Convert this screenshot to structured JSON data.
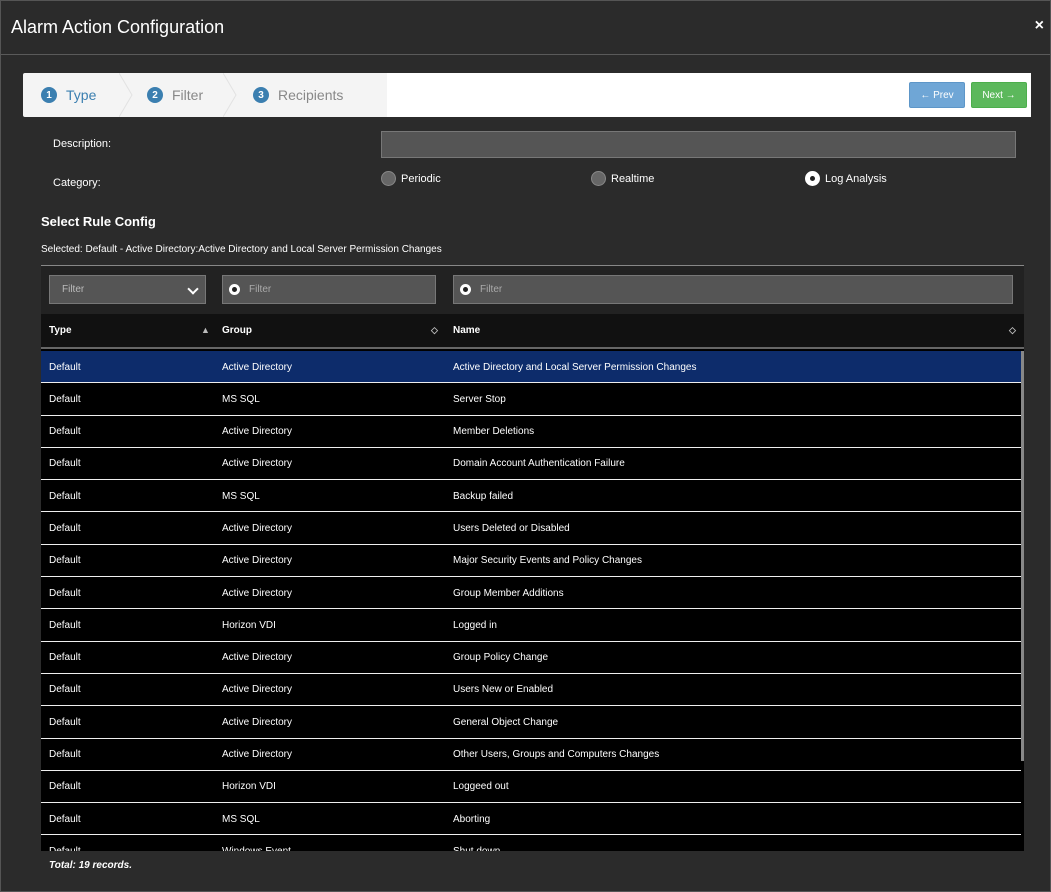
{
  "window": {
    "title": "Alarm Action Configuration",
    "close": "×"
  },
  "wizard": {
    "steps": [
      {
        "num": "1",
        "label": "Type"
      },
      {
        "num": "2",
        "label": "Filter"
      },
      {
        "num": "3",
        "label": "Recipients"
      }
    ],
    "prev_label": "← Prev",
    "next_label": "Next →"
  },
  "form": {
    "description_label": "Description:",
    "description_value": "",
    "category_label": "Category:",
    "categories": [
      {
        "label": "Periodic",
        "selected": false
      },
      {
        "label": "Realtime",
        "selected": false
      },
      {
        "label": "Log Analysis",
        "selected": true
      }
    ]
  },
  "rule_config": {
    "title": "Select Rule Config",
    "selected_text": "Selected: Default - Active Directory:Active Directory and Local Server Permission Changes"
  },
  "table": {
    "filters": {
      "type_placeholder": "Filter",
      "group_placeholder": "Filter",
      "name_placeholder": "Filter"
    },
    "columns": [
      "Type",
      "Group",
      "Name"
    ],
    "rows": [
      [
        "Default",
        "Active Directory",
        "Active Directory and Local Server Permission Changes"
      ],
      [
        "Default",
        "MS SQL",
        "Server Stop"
      ],
      [
        "Default",
        "Active Directory",
        "Member Deletions"
      ],
      [
        "Default",
        "Active Directory",
        "Domain Account Authentication Failure"
      ],
      [
        "Default",
        "MS SQL",
        "Backup failed"
      ],
      [
        "Default",
        "Active Directory",
        "Users Deleted or Disabled"
      ],
      [
        "Default",
        "Active Directory",
        "Major Security Events and Policy Changes"
      ],
      [
        "Default",
        "Active Directory",
        "Group Member Additions"
      ],
      [
        "Default",
        "Horizon VDI",
        "Logged in"
      ],
      [
        "Default",
        "Active Directory",
        "Group Policy Change"
      ],
      [
        "Default",
        "Active Directory",
        "Users New or Enabled"
      ],
      [
        "Default",
        "Active Directory",
        "General Object Change"
      ],
      [
        "Default",
        "Active Directory",
        "Other Users, Groups and Computers Changes"
      ],
      [
        "Default",
        "Horizon VDI",
        "Loggeed out"
      ],
      [
        "Default",
        "MS SQL",
        "Aborting"
      ],
      [
        "Default",
        "Windows Event",
        "Shut down"
      ]
    ],
    "selected_row": 0,
    "total": "Total: 19 records."
  },
  "colors": {
    "selected_row": "#0d2c6b",
    "wizard_active": "#3b7fb0",
    "next_button": "#5cb85c",
    "prev_button": "#6fa6d6"
  }
}
